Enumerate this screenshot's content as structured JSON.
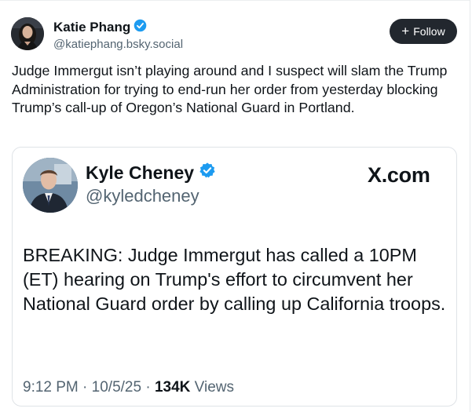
{
  "post": {
    "author": {
      "name": "Katie Phang",
      "handle": "@katiephang.bsky.social",
      "verified": true
    },
    "follow_label": "Follow",
    "text": "Judge Immergut isn’t playing around and I suspect will slam the Trump Administration for trying to end-run her order from yesterday blocking Trump’s call-up of Oregon’s National Guard in Portland."
  },
  "embed": {
    "author": {
      "name": "Kyle Cheney",
      "handle": "@kyledcheney",
      "verified": true
    },
    "source_logo": "X.com",
    "text": "BREAKING: Judge Immergut has called a 10PM (ET) hearing on Trump's effort to circumvent her National Guard order by calling up California troops.",
    "time": "9:12 PM",
    "date": "10/5/25",
    "views_count": "134K",
    "views_label": "Views"
  },
  "colors": {
    "verified_badge": "#1d9bf0",
    "follow_button_bg": "#22272e",
    "secondary_text": "#536471",
    "primary_text": "#0f1419"
  }
}
